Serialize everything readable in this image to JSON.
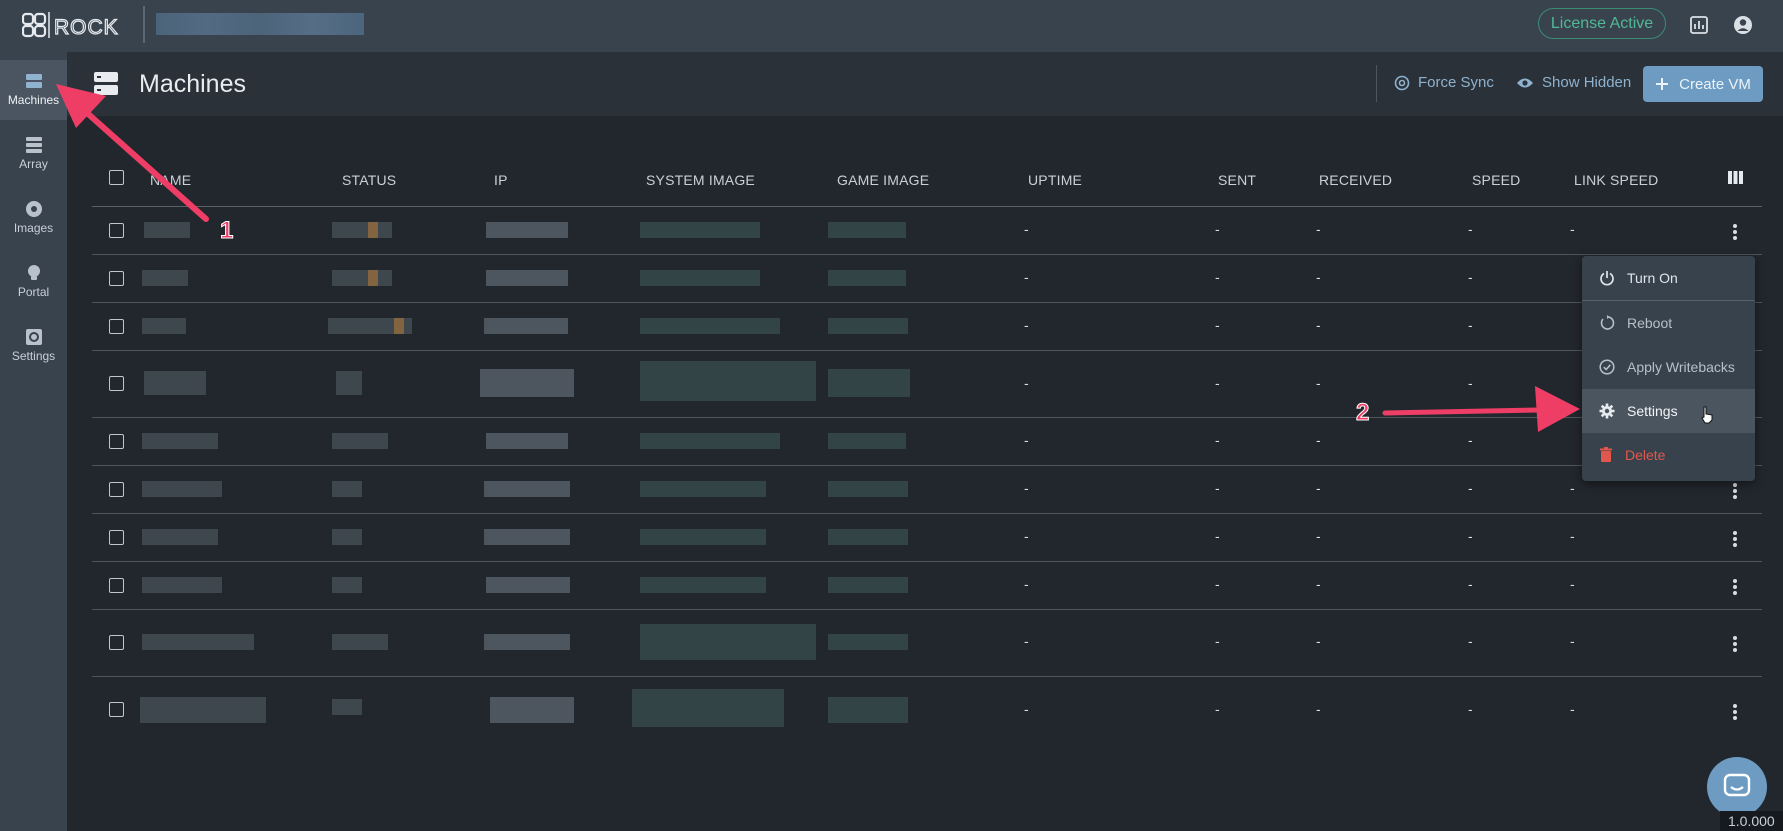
{
  "topbar": {
    "logo_text": "ggROCK",
    "license_badge": "License Active",
    "icons": [
      "stats-icon",
      "account-icon"
    ]
  },
  "sidebar": {
    "items": [
      {
        "label": "Machines",
        "icon": "server-icon",
        "active": true
      },
      {
        "label": "Array",
        "icon": "array-icon",
        "active": false
      },
      {
        "label": "Images",
        "icon": "disc-icon",
        "active": false
      },
      {
        "label": "Portal",
        "icon": "lightbulb-icon",
        "active": false
      },
      {
        "label": "Settings",
        "icon": "gear-box-icon",
        "active": false
      }
    ]
  },
  "header": {
    "title": "Machines",
    "force_sync": "Force Sync",
    "show_hidden": "Show Hidden",
    "create_vm": "Create VM"
  },
  "table": {
    "columns": [
      "NAME",
      "STATUS",
      "IP",
      "SYSTEM IMAGE",
      "GAME IMAGE",
      "UPTIME",
      "SENT",
      "RECEIVED",
      "SPEED",
      "LINK SPEED"
    ],
    "empty_value": "-",
    "row_count": 10
  },
  "context_menu": {
    "items": [
      {
        "label": "Turn On",
        "icon": "power-icon"
      },
      {
        "label": "Reboot",
        "icon": "restart-icon"
      },
      {
        "label": "Apply Writebacks",
        "icon": "check-circle-icon"
      },
      {
        "label": "Settings",
        "icon": "gear-icon",
        "highlighted": true
      },
      {
        "label": "Delete",
        "icon": "trash-icon",
        "danger": true
      }
    ]
  },
  "annotations": {
    "step1": "1",
    "step2": "2",
    "arrow_color": "#ee3e66"
  },
  "footer": {
    "version": "1.0.000"
  },
  "colors": {
    "accent": "#6e9bc1",
    "license_green": "#52b796",
    "danger": "#e1574d"
  }
}
